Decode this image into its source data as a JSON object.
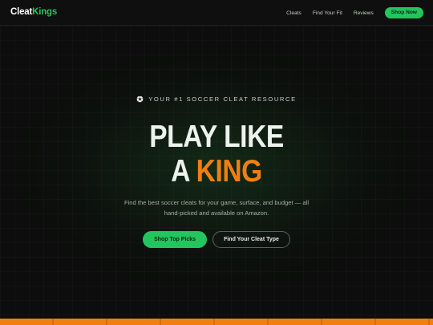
{
  "brand": {
    "logo_part1": "Cleat",
    "logo_part2": "Kings"
  },
  "nav": {
    "links": [
      "Cleats",
      "Find Your Fit",
      "Reviews"
    ],
    "cta": "Shop Now"
  },
  "hero": {
    "eyebrow_icon": "soccer-ball-icon",
    "eyebrow": "YOUR #1 SOCCER CLEAT RESOURCE",
    "headline_line1": "PLAY LIKE",
    "headline_line2_prefix": "A",
    "headline_line2_accent": "KING",
    "subtext": "Find the best soccer cleats for your game, surface, and budget — all hand-picked and available on Amazon.",
    "primary_button": "Shop Top Picks",
    "secondary_button": "Find Your Cleat Type"
  },
  "colors": {
    "accent_green": "#22c55e",
    "accent_orange": "#f07f12",
    "background": "#0c0d0c"
  }
}
